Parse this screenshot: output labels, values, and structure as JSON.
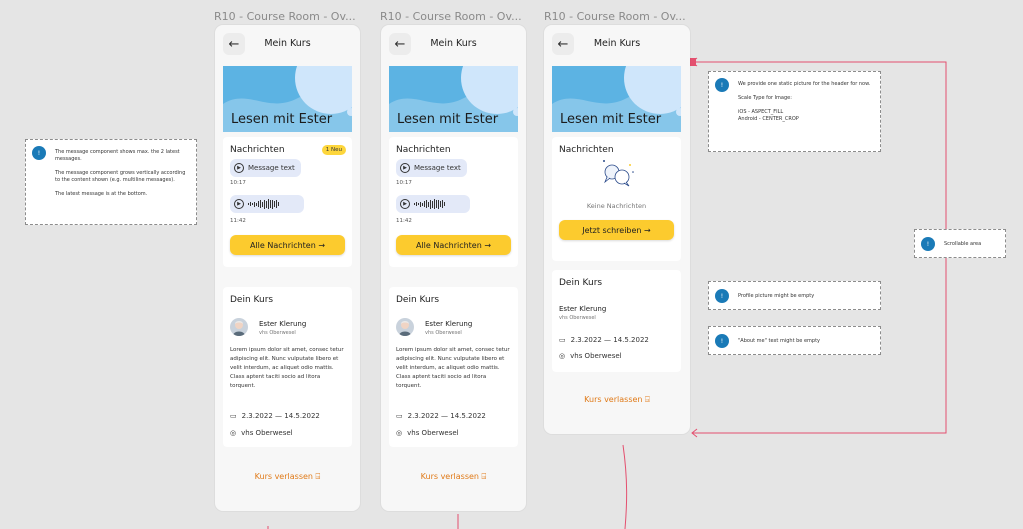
{
  "frames": [
    {
      "title": "R10 - Course Room - Ov..."
    },
    {
      "title": "R10 - Course Room - Ov..."
    },
    {
      "title": "R10 - Course Room - Ov..."
    }
  ],
  "screen": {
    "back_icon": "arrow-left-icon",
    "title": "Mein Kurs",
    "hero_title": "Lesen mit Ester",
    "messages_title": "Nachrichten",
    "messages_badge": "1 Neu",
    "message_text": "Message text",
    "message_time_1": "10:17",
    "message_time_2": "11:42",
    "all_messages_button": "Alle Nachrichten →",
    "empty_messages": "Keine Nachrichten",
    "write_button": "Jetzt schreiben →",
    "course_title": "Dein Kurs",
    "teacher_name": "Ester Klerung",
    "teacher_org": "vhs Oberwesel",
    "about_text": "Lorem ipsum dolor sit amet, consec tetur adipiscing elit. Nunc vulputate libero et velit interdum, ac aliquet odio mattis. Class aptent taciti socio ad litora torquent.",
    "date_range": "2.3.2022 — 14.5.2022",
    "location": "vhs Oberwesel",
    "leave_button": "Kurs verlassen"
  },
  "notes": {
    "left": [
      "The message component shows max. the 2 latest messages.",
      "The message component grows vertically according to the content shown (e.g. multiline messages).",
      "The latest message is at the bottom."
    ],
    "header": [
      "We provide one static picture for the header for now.",
      "Scale Type for Image:",
      "iOS - ASPECT_FILL\nAndroid - CENTER_CROP"
    ],
    "scroll": "Scrollable area",
    "profile": "Profile picture might be empty",
    "about": "\"About me\" text might be empty",
    "marker": "!"
  },
  "colors": {
    "accent_yellow": "#fccb2e",
    "hero_blue": "#5cb3e3",
    "leave_orange": "#e07a18",
    "note_blue": "#1a7ab7",
    "connector_pink": "#e4506f"
  }
}
